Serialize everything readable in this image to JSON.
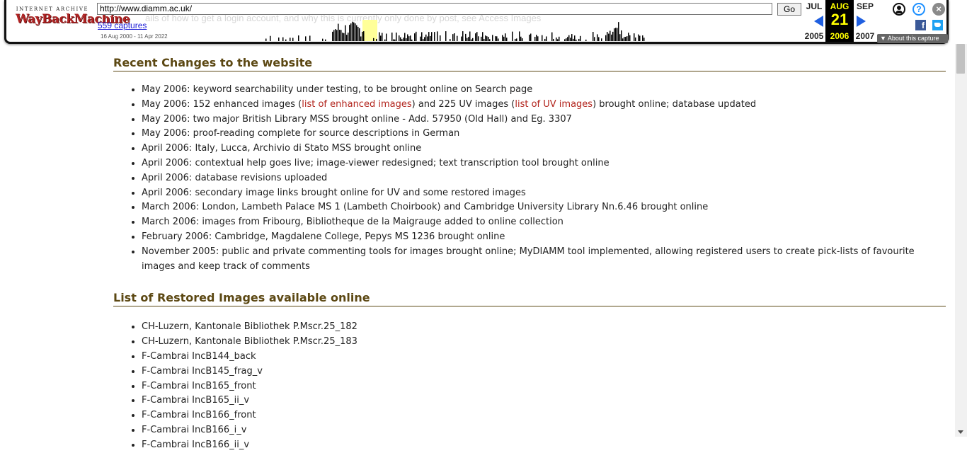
{
  "toolbar": {
    "logo_top": "INTERNET ARCHIVE",
    "logo_main": "WayBackMachine",
    "url": "http://www.diamm.ac.uk/",
    "go_label": "Go",
    "captures_label": "559 captures",
    "date_range": "16 Aug 2000 - 11 Apr 2022",
    "ghost_text": "ails of how to get a login account, and why this is currently only done by post, see Access Images",
    "prev": {
      "month": "JUL",
      "year": "2005"
    },
    "current": {
      "month": "AUG",
      "day": "21",
      "year": "2006"
    },
    "next": {
      "month": "SEP",
      "year": "2007"
    },
    "about_label": "About this capture",
    "fb_glyph": "f"
  },
  "sections": [
    {
      "heading": "Recent Changes to the website",
      "items": [
        {
          "text": "May 2006: keyword searchability under testing, to be brought online on Search page"
        },
        {
          "parts": [
            "May 2006: 152 enhanced images (",
            "list of enhanced images",
            ") and 225 UV images (",
            "list of UV images",
            ") brought online; database updated"
          ]
        },
        {
          "text": "May 2006: two major British Library MSS brought online - Add. 57950 (Old Hall) and Eg. 3307"
        },
        {
          "text": "May 2006: proof-reading complete for source descriptions in German"
        },
        {
          "text": "April 2006: Italy, Lucca, Archivio di Stato MSS brought online"
        },
        {
          "text": "April 2006: contextual help goes live; image-viewer redesigned; text transcription tool brought online"
        },
        {
          "text": "April 2006: database revisions uploaded"
        },
        {
          "text": "April 2006: secondary image links brought online for UV and some restored images"
        },
        {
          "text": "March 2006: London, Lambeth Palace MS 1 (Lambeth Choirbook) and Cambridge University Library Nn.6.46 brought online"
        },
        {
          "text": "March 2006: images from Fribourg, Bibliotheque de la Maigrauge added to online collection"
        },
        {
          "text": "February 2006: Cambridge, Magdalene College, Pepys MS 1236 brought online"
        },
        {
          "text": "November 2005: public and private commenting tools for images brought online; MyDIAMM tool implemented, allowing registered users to create pick-lists of favourite images and keep track of comments"
        }
      ]
    },
    {
      "heading": "List of Restored Images available online",
      "items": [
        "CH-Luzern, Kantonale Bibliothek P.Mscr.25_182",
        "CH-Luzern, Kantonale Bibliothek P.Mscr.25_183",
        "F-Cambrai IncB144_back",
        "F-Cambrai IncB145_frag_v",
        "F-Cambrai IncB165_front",
        "F-Cambrai IncB165_ii_v",
        "F-Cambrai IncB166_front",
        "F-Cambrai IncB166_i_v",
        "F-Cambrai IncB166_ii_v"
      ]
    }
  ],
  "colors": {
    "heading": "#5c4813",
    "link": "#b2241c",
    "calendar_highlight": "#ffff00",
    "sparkline_bar": "#000000",
    "sparkline_highlight": "#ffff99"
  }
}
